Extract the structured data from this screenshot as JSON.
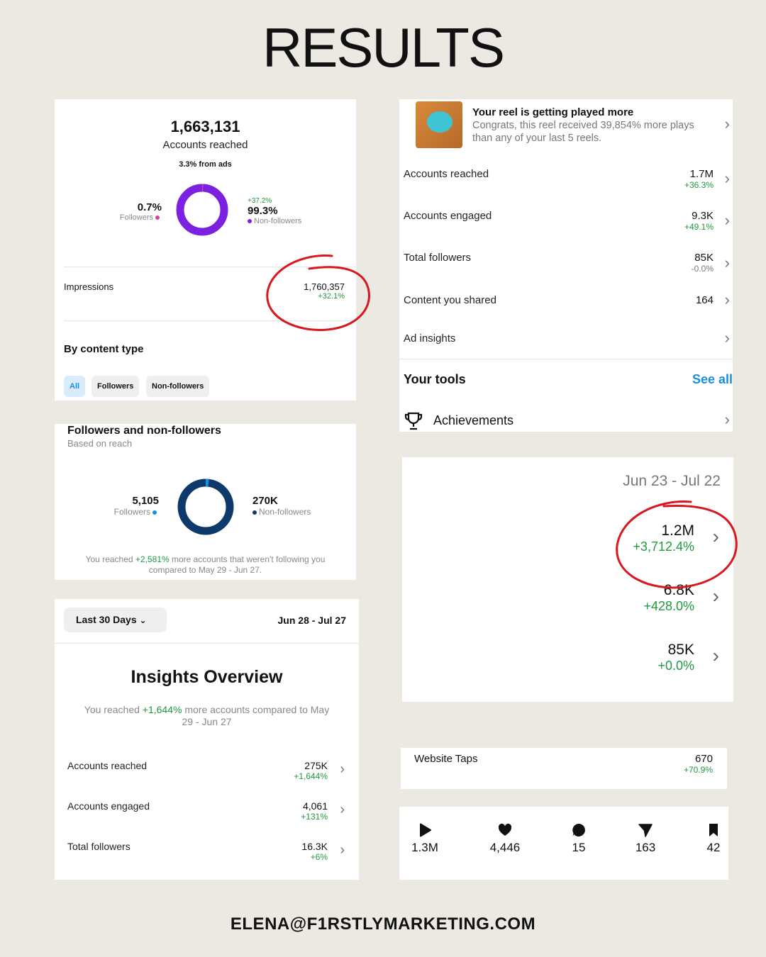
{
  "title": "RESULTS",
  "footer": "ELENA@F1RSTLYMARKETING.COM",
  "colors": {
    "background": "#ece9e3",
    "green": "#1f9a3e",
    "accent_blue": "#1a8ee0",
    "purple": "#7b22e0",
    "navy": "#0e3a6b",
    "annotation_red": "#d9171e"
  },
  "reach_card": {
    "accounts_reached_value": "1,663,131",
    "accounts_reached_label": "Accounts reached",
    "from_ads": "3.3% from ads",
    "followers_pct": "0.7%",
    "followers_label": "Followers",
    "nonfollowers_change": "+37.2%",
    "nonfollowers_pct": "99.3%",
    "nonfollowers_label": "Non-followers",
    "donut_share_followers": 0.7,
    "impressions_label": "Impressions",
    "impressions_value": "1,760,357",
    "impressions_change": "+32.1%",
    "by_content_type": "By content type",
    "chips": [
      "All",
      "Followers",
      "Non-followers"
    ]
  },
  "reel_card": {
    "notif_title": "Your reel is getting played more",
    "notif_body": "Congrats, this reel received 39,854% more plays than any of your last 5 reels.",
    "rows": [
      {
        "label": "Accounts reached",
        "value": "1.7M",
        "change": "+36.3%"
      },
      {
        "label": "Accounts engaged",
        "value": "9.3K",
        "change": "+49.1%"
      },
      {
        "label": "Total followers",
        "value": "85K",
        "change": "-0.0%"
      },
      {
        "label": "Content you shared",
        "value": "164",
        "change": ""
      },
      {
        "label": "Ad insights",
        "value": "",
        "change": ""
      }
    ],
    "tools_title": "Your tools",
    "see_all": "See all",
    "achievements": "Achievements"
  },
  "followers_card": {
    "title": "Followers and non-followers",
    "subtitle": "Based on reach",
    "followers_value": "5,105",
    "followers_label": "Followers",
    "nonfollowers_value": "270K",
    "nonfollowers_label": "Non-followers",
    "donut_share_followers": 1.9,
    "note_pre": "You reached ",
    "note_pct": "+2,581%",
    "note_post": " more accounts that weren't following you compared to May 29 - Jun 27."
  },
  "range_card": {
    "date_range": "Jun 23 - Jul 22",
    "rows": [
      {
        "value": "1.2M",
        "change": "+3,712.4%"
      },
      {
        "value": "6.8K",
        "change": "+428.0%"
      },
      {
        "value": "85K",
        "change": "+0.0%"
      }
    ]
  },
  "overview_card": {
    "dropdown": "Last 30 Days",
    "date_range": "Jun 28 - Jul 27",
    "title": "Insights Overview",
    "sub_pre": "You reached ",
    "sub_pct": "+1,644%",
    "sub_post": " more accounts compared to May 29 - Jun 27",
    "rows": [
      {
        "label": "Accounts reached",
        "value": "275K",
        "change": "+1,644%"
      },
      {
        "label": "Accounts engaged",
        "value": "4,061",
        "change": "+131%"
      },
      {
        "label": "Total followers",
        "value": "16.3K",
        "change": "+6%"
      }
    ]
  },
  "website_card": {
    "label": "Website Taps",
    "value": "670",
    "change": "+70.9%"
  },
  "stats_card": {
    "items": [
      {
        "icon": "play-icon",
        "value": "1.3M"
      },
      {
        "icon": "heart-icon",
        "value": "4,446"
      },
      {
        "icon": "comment-icon",
        "value": "15"
      },
      {
        "icon": "send-icon",
        "value": "163"
      },
      {
        "icon": "bookmark-icon",
        "value": "42"
      }
    ]
  }
}
